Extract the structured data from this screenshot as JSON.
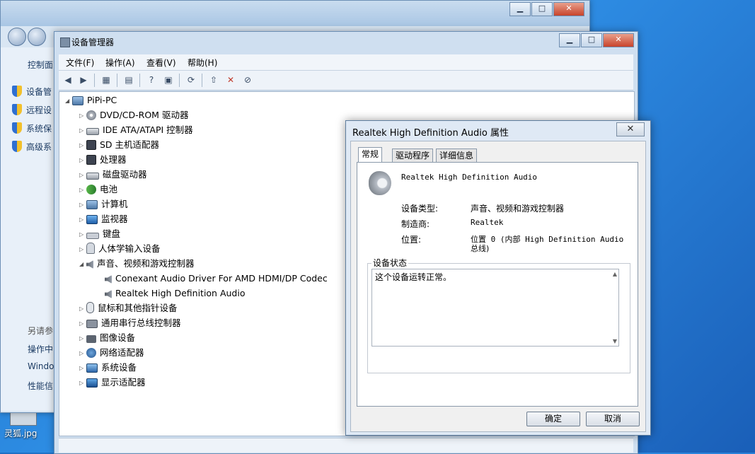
{
  "desktop": {
    "file_label": "灵狐.jpg"
  },
  "control_panel": {
    "breadcrumb": "控制面",
    "side_items": [
      {
        "label": "设备管"
      },
      {
        "label": "远程设"
      },
      {
        "label": "系统保"
      },
      {
        "label": "高级系"
      }
    ],
    "see_also_title": "另请参",
    "see_also": [
      {
        "label": "操作中"
      },
      {
        "label": "Windo"
      },
      {
        "label": "性能信"
      }
    ]
  },
  "device_manager": {
    "title": "设备管理器",
    "menu": [
      {
        "label": "文件(F)"
      },
      {
        "label": "操作(A)"
      },
      {
        "label": "查看(V)"
      },
      {
        "label": "帮助(H)"
      }
    ],
    "root": "PiPi-PC",
    "tree": [
      {
        "label": "DVD/CD-ROM 驱动器",
        "icon": "disc-icon"
      },
      {
        "label": "IDE ATA/ATAPI 控制器",
        "icon": "drive-icon"
      },
      {
        "label": "SD 主机适配器",
        "icon": "chip-icon"
      },
      {
        "label": "处理器",
        "icon": "chip-icon"
      },
      {
        "label": "磁盘驱动器",
        "icon": "drive-icon"
      },
      {
        "label": "电池",
        "icon": "battery-icon"
      },
      {
        "label": "计算机",
        "icon": "computer-icon"
      },
      {
        "label": "监视器",
        "icon": "monitor-icon"
      },
      {
        "label": "键盘",
        "icon": "keyboard-icon"
      },
      {
        "label": "人体学输入设备",
        "icon": "hid-icon"
      },
      {
        "label": "声音、视频和游戏控制器",
        "icon": "speaker-icon"
      },
      {
        "label": "Conexant Audio Driver For AMD HDMI/DP Codec",
        "icon": "speaker-icon"
      },
      {
        "label": "Realtek High Definition Audio",
        "icon": "speaker-icon"
      },
      {
        "label": "鼠标和其他指针设备",
        "icon": "mouse-icon"
      },
      {
        "label": "通用串行总线控制器",
        "icon": "usb-icon"
      },
      {
        "label": "图像设备",
        "icon": "camera-icon"
      },
      {
        "label": "网络适配器",
        "icon": "network-icon"
      },
      {
        "label": "系统设备",
        "icon": "system-icon"
      },
      {
        "label": "显示适配器",
        "icon": "display-icon"
      }
    ]
  },
  "properties": {
    "title": "Realtek High Definition Audio 属性",
    "close_glyph": "✕",
    "tabs": [
      {
        "label": "常规"
      },
      {
        "label": "驱动程序"
      },
      {
        "label": "详细信息"
      }
    ],
    "device_name": "Realtek High Definition Audio",
    "fields": {
      "type_label": "设备类型:",
      "type_value": "声音、视频和游戏控制器",
      "maker_label": "制造商:",
      "maker_value": "Realtek",
      "location_label": "位置:",
      "location_value_line1": "位置 0 (内部 High Definition Audio",
      "location_value_line2": "总线)"
    },
    "status_legend": "设备状态",
    "status_text": "这个设备运转正常。",
    "ok_label": "确定",
    "cancel_label": "取消"
  }
}
